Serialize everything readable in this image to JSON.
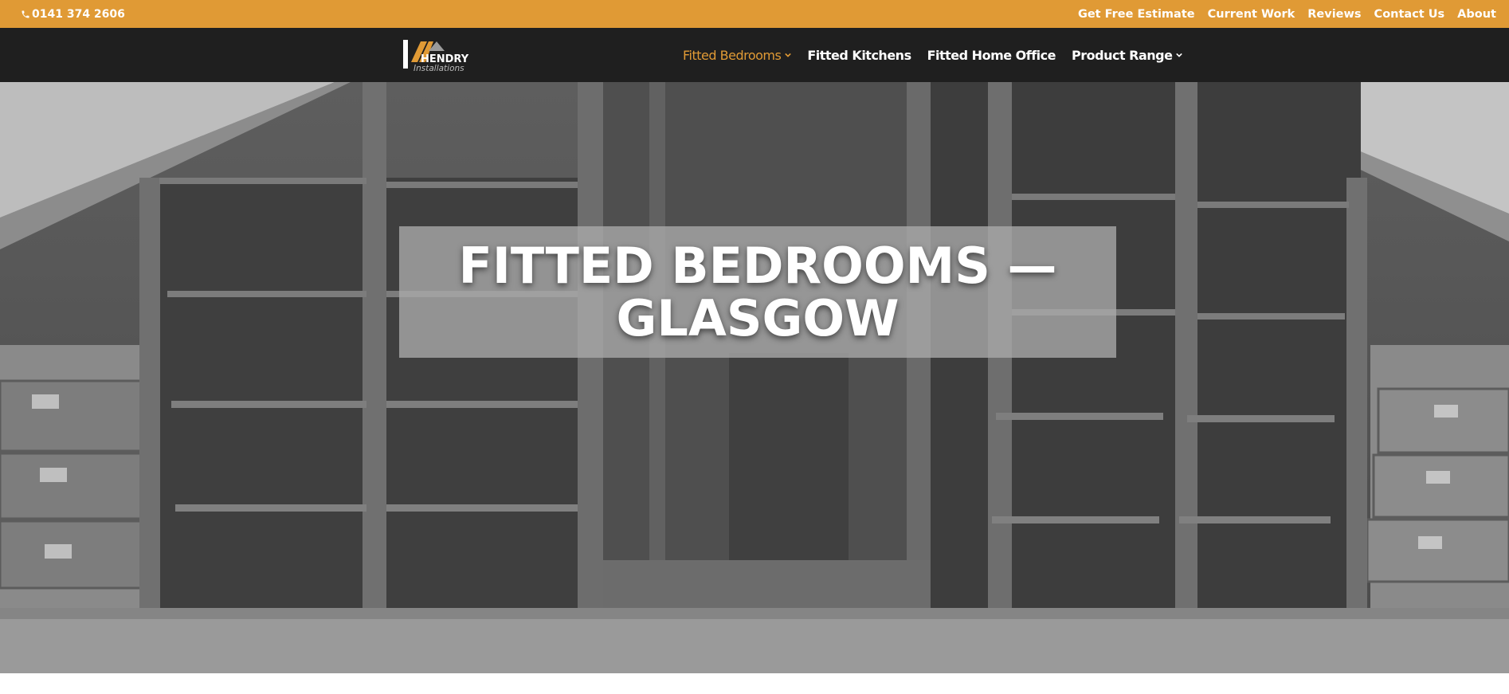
{
  "topbar": {
    "phone_icon": "phone-icon",
    "phone": "0141 374 2606",
    "links": [
      "Get Free Estimate",
      "Current Work",
      "Reviews",
      "Contact Us",
      "About"
    ]
  },
  "header": {
    "logo_text": "HENDRY",
    "logo_sub": "Installations",
    "nav": [
      {
        "label": "Fitted Bedrooms",
        "dropdown": true,
        "active": true
      },
      {
        "label": "Fitted Kitchens",
        "dropdown": false
      },
      {
        "label": "Fitted Home Office",
        "dropdown": false
      },
      {
        "label": "Product Range",
        "dropdown": true
      }
    ]
  },
  "hero": {
    "title_line1": "FITTED BEDROOMS —",
    "title_line2": "GLASGOW"
  },
  "colors": {
    "accent": "#e09a35",
    "header_bg": "#1f1f1f"
  }
}
